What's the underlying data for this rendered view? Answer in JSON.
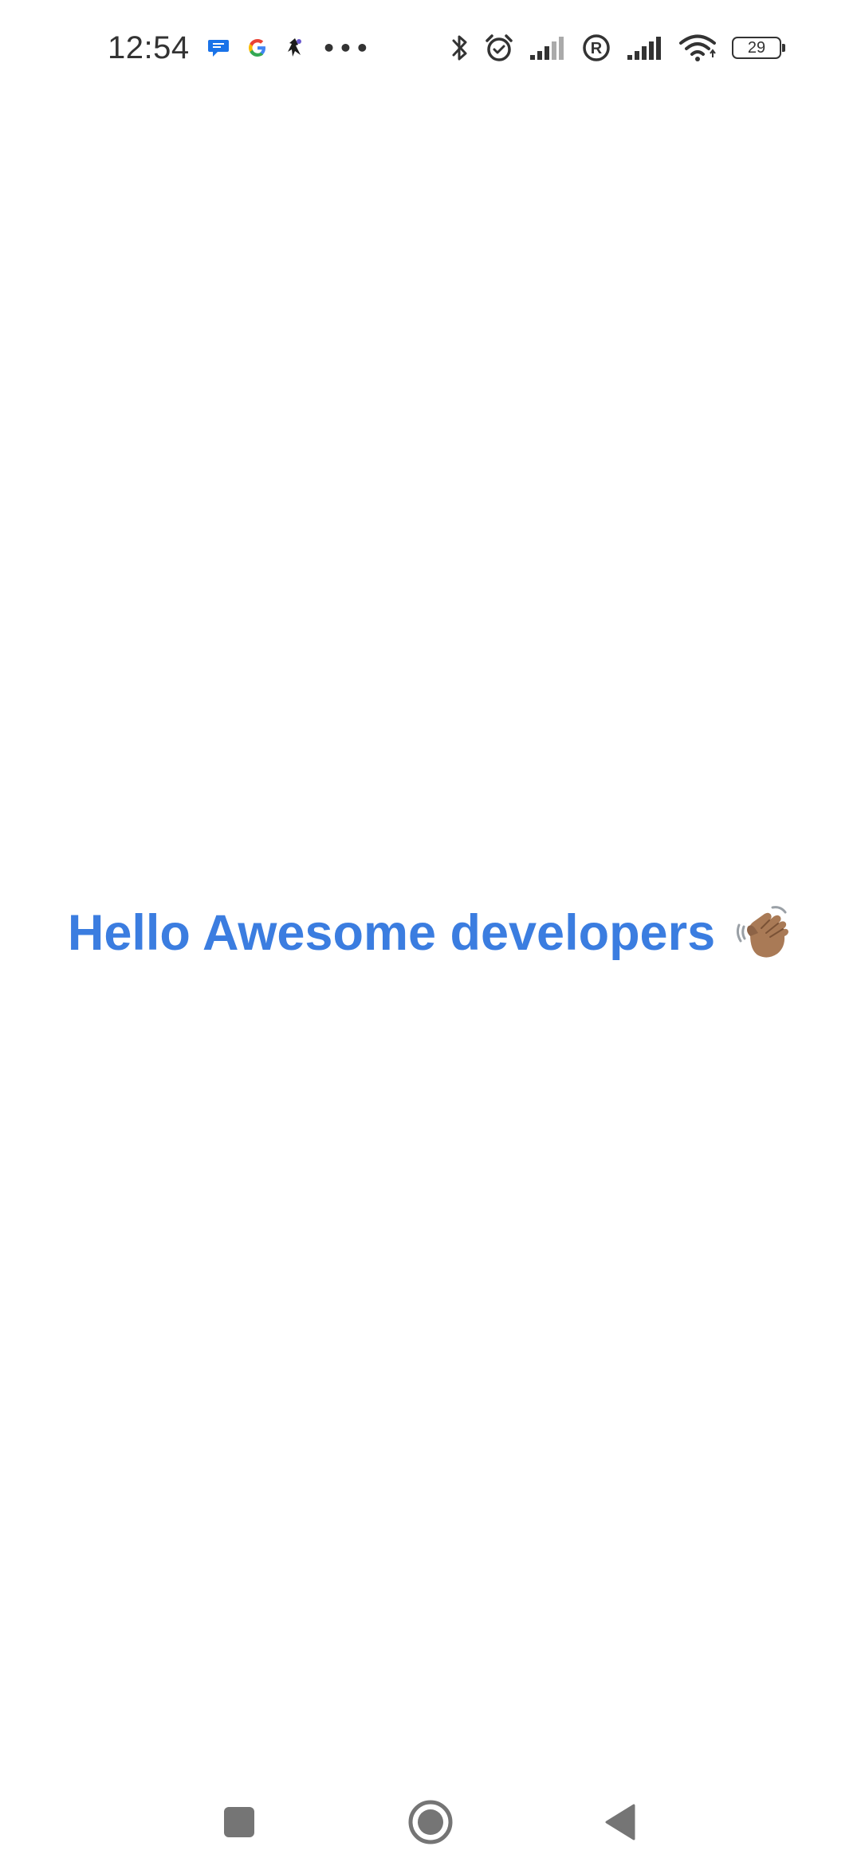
{
  "status_bar": {
    "time": "12:54",
    "battery": "29",
    "left_icons": [
      "messages-icon",
      "google-icon",
      "app-notification-icon",
      "more-notifications-icon"
    ],
    "right_icons": [
      "bluetooth-icon",
      "alarm-icon",
      "signal-icon",
      "roaming-icon",
      "signal-icon",
      "wifi-icon",
      "battery-icon"
    ]
  },
  "main": {
    "greeting": "Hello Awesome developers",
    "emoji": "waving-hand-icon"
  },
  "nav_bar": {
    "buttons": [
      "recents-button",
      "home-button",
      "back-button"
    ]
  },
  "colors": {
    "accent": "#3b7de0",
    "background": "#ffffff",
    "status_text": "#333333",
    "nav_icon": "#757575"
  }
}
